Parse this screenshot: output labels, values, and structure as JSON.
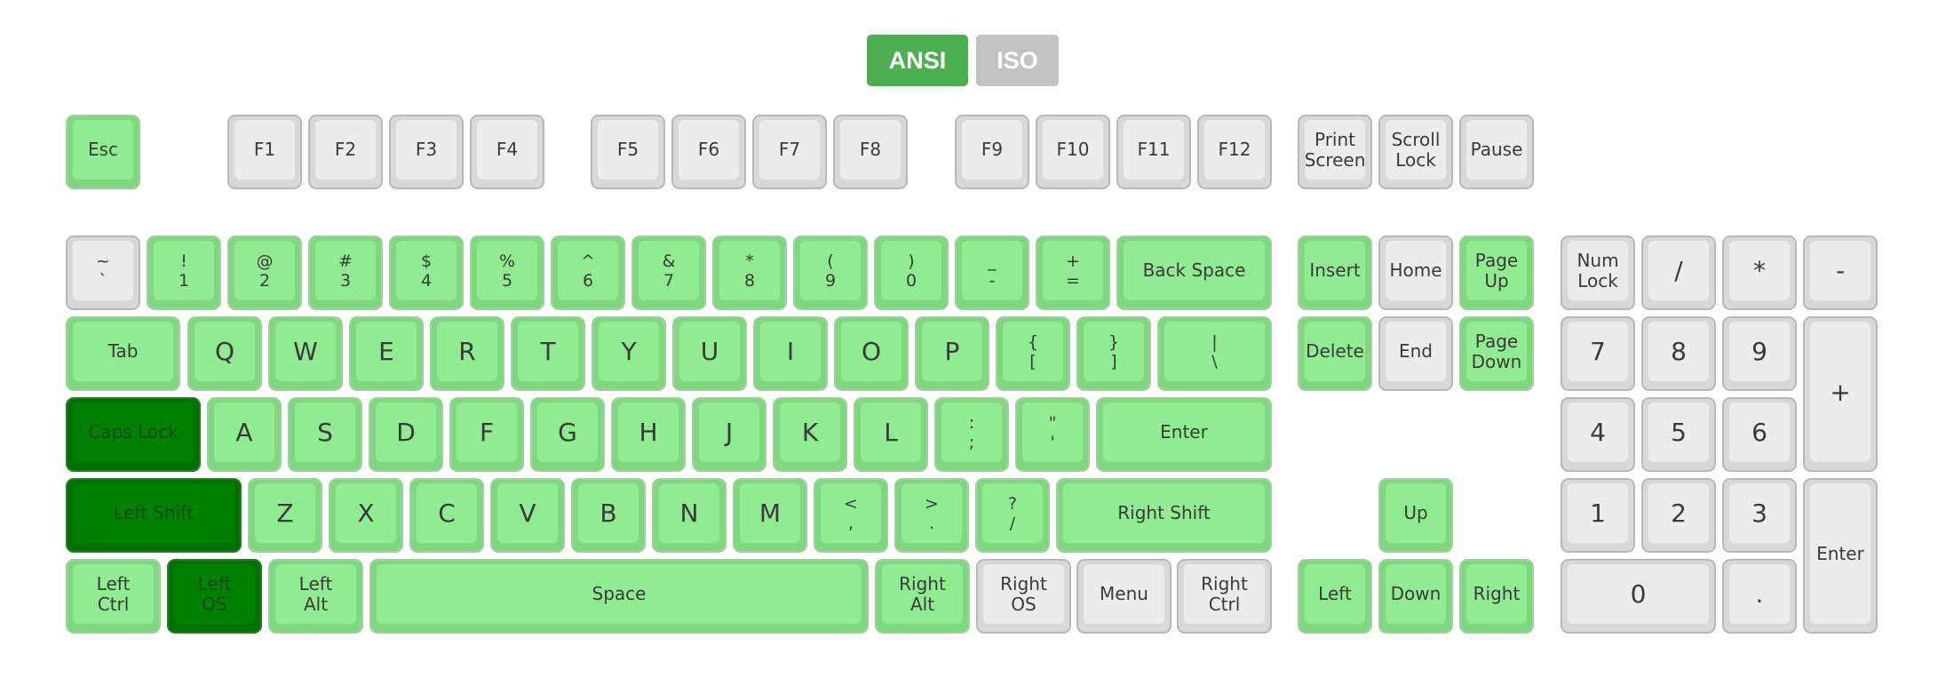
{
  "layout_toggle": {
    "ansi_label": "ANSI",
    "iso_label": "ISO",
    "selected": "ANSI"
  },
  "colors": {
    "pressed": "#90ec90",
    "held": "#008000",
    "idle": "#ececec",
    "toggle_active": "#4caf50",
    "toggle_inactive": "#c2c2c2"
  },
  "keys": [
    {
      "id": "esc",
      "lines": [
        "Esc"
      ],
      "state": "green"
    },
    {
      "id": "f1",
      "lines": [
        "F1"
      ],
      "state": "idle"
    },
    {
      "id": "f2",
      "lines": [
        "F2"
      ],
      "state": "idle"
    },
    {
      "id": "f3",
      "lines": [
        "F3"
      ],
      "state": "idle"
    },
    {
      "id": "f4",
      "lines": [
        "F4"
      ],
      "state": "idle"
    },
    {
      "id": "f5",
      "lines": [
        "F5"
      ],
      "state": "idle"
    },
    {
      "id": "f6",
      "lines": [
        "F6"
      ],
      "state": "idle"
    },
    {
      "id": "f7",
      "lines": [
        "F7"
      ],
      "state": "idle"
    },
    {
      "id": "f8",
      "lines": [
        "F8"
      ],
      "state": "idle"
    },
    {
      "id": "f9",
      "lines": [
        "F9"
      ],
      "state": "idle"
    },
    {
      "id": "f10",
      "lines": [
        "F10"
      ],
      "state": "idle"
    },
    {
      "id": "f11",
      "lines": [
        "F11"
      ],
      "state": "idle"
    },
    {
      "id": "f12",
      "lines": [
        "F12"
      ],
      "state": "idle"
    },
    {
      "id": "print-screen",
      "lines": [
        "Print",
        "Screen"
      ],
      "state": "idle"
    },
    {
      "id": "scroll-lock",
      "lines": [
        "Scroll",
        "Lock"
      ],
      "state": "idle"
    },
    {
      "id": "pause",
      "lines": [
        "Pause"
      ],
      "state": "idle"
    },
    {
      "id": "backtick",
      "lines": [
        "~",
        "`"
      ],
      "state": "idle"
    },
    {
      "id": "digit-1",
      "lines": [
        "!",
        "1"
      ],
      "state": "green"
    },
    {
      "id": "digit-2",
      "lines": [
        "@",
        "2"
      ],
      "state": "green"
    },
    {
      "id": "digit-3",
      "lines": [
        "#",
        "3"
      ],
      "state": "green"
    },
    {
      "id": "digit-4",
      "lines": [
        "$",
        "4"
      ],
      "state": "green"
    },
    {
      "id": "digit-5",
      "lines": [
        "%",
        "5"
      ],
      "state": "green"
    },
    {
      "id": "digit-6",
      "lines": [
        "^",
        "6"
      ],
      "state": "green"
    },
    {
      "id": "digit-7",
      "lines": [
        "&",
        "7"
      ],
      "state": "green"
    },
    {
      "id": "digit-8",
      "lines": [
        "*",
        "8"
      ],
      "state": "green"
    },
    {
      "id": "digit-9",
      "lines": [
        "(",
        "9"
      ],
      "state": "green"
    },
    {
      "id": "digit-0",
      "lines": [
        ")",
        "0"
      ],
      "state": "green"
    },
    {
      "id": "minus",
      "lines": [
        "_",
        "-"
      ],
      "state": "green"
    },
    {
      "id": "equal",
      "lines": [
        "+",
        "="
      ],
      "state": "green"
    },
    {
      "id": "backspace",
      "lines": [
        "Back Space"
      ],
      "state": "green"
    },
    {
      "id": "insert",
      "lines": [
        "Insert"
      ],
      "state": "green"
    },
    {
      "id": "home",
      "lines": [
        "Home"
      ],
      "state": "idle"
    },
    {
      "id": "page-up",
      "lines": [
        "Page",
        "Up"
      ],
      "state": "green"
    },
    {
      "id": "num-lock",
      "lines": [
        "Num",
        "Lock"
      ],
      "state": "idle"
    },
    {
      "id": "numpad-divide",
      "lines": [
        "/"
      ],
      "state": "idle"
    },
    {
      "id": "numpad-multiply",
      "lines": [
        "*"
      ],
      "state": "idle"
    },
    {
      "id": "numpad-minus",
      "lines": [
        "-"
      ],
      "state": "idle"
    },
    {
      "id": "tab",
      "lines": [
        "Tab"
      ],
      "state": "green"
    },
    {
      "id": "q",
      "lines": [
        "Q"
      ],
      "state": "green"
    },
    {
      "id": "w",
      "lines": [
        "W"
      ],
      "state": "green"
    },
    {
      "id": "e",
      "lines": [
        "E"
      ],
      "state": "green"
    },
    {
      "id": "r",
      "lines": [
        "R"
      ],
      "state": "green"
    },
    {
      "id": "t",
      "lines": [
        "T"
      ],
      "state": "green"
    },
    {
      "id": "y",
      "lines": [
        "Y"
      ],
      "state": "green"
    },
    {
      "id": "u",
      "lines": [
        "U"
      ],
      "state": "green"
    },
    {
      "id": "i",
      "lines": [
        "I"
      ],
      "state": "green"
    },
    {
      "id": "o",
      "lines": [
        "O"
      ],
      "state": "green"
    },
    {
      "id": "p",
      "lines": [
        "P"
      ],
      "state": "green"
    },
    {
      "id": "bracket-left",
      "lines": [
        "{",
        "["
      ],
      "state": "green"
    },
    {
      "id": "bracket-right",
      "lines": [
        "}",
        "]"
      ],
      "state": "green"
    },
    {
      "id": "backslash",
      "lines": [
        "|",
        "\\"
      ],
      "state": "green"
    },
    {
      "id": "delete",
      "lines": [
        "Delete"
      ],
      "state": "green"
    },
    {
      "id": "end",
      "lines": [
        "End"
      ],
      "state": "idle"
    },
    {
      "id": "page-down",
      "lines": [
        "Page",
        "Down"
      ],
      "state": "green"
    },
    {
      "id": "numpad-7",
      "lines": [
        "7"
      ],
      "state": "idle"
    },
    {
      "id": "numpad-8",
      "lines": [
        "8"
      ],
      "state": "idle"
    },
    {
      "id": "numpad-9",
      "lines": [
        "9"
      ],
      "state": "idle"
    },
    {
      "id": "numpad-plus",
      "lines": [
        "+"
      ],
      "state": "idle"
    },
    {
      "id": "caps-lock",
      "lines": [
        "Caps Lock"
      ],
      "state": "dark"
    },
    {
      "id": "a",
      "lines": [
        "A"
      ],
      "state": "green"
    },
    {
      "id": "s",
      "lines": [
        "S"
      ],
      "state": "green"
    },
    {
      "id": "d",
      "lines": [
        "D"
      ],
      "state": "green"
    },
    {
      "id": "f",
      "lines": [
        "F"
      ],
      "state": "green"
    },
    {
      "id": "g",
      "lines": [
        "G"
      ],
      "state": "green"
    },
    {
      "id": "h",
      "lines": [
        "H"
      ],
      "state": "green"
    },
    {
      "id": "j",
      "lines": [
        "J"
      ],
      "state": "green"
    },
    {
      "id": "k",
      "lines": [
        "K"
      ],
      "state": "green"
    },
    {
      "id": "l",
      "lines": [
        "L"
      ],
      "state": "green"
    },
    {
      "id": "semicolon",
      "lines": [
        ":",
        ";"
      ],
      "state": "green"
    },
    {
      "id": "quote",
      "lines": [
        "\"",
        "'"
      ],
      "state": "green"
    },
    {
      "id": "enter",
      "lines": [
        "Enter"
      ],
      "state": "green"
    },
    {
      "id": "numpad-4",
      "lines": [
        "4"
      ],
      "state": "idle"
    },
    {
      "id": "numpad-5",
      "lines": [
        "5"
      ],
      "state": "idle"
    },
    {
      "id": "numpad-6",
      "lines": [
        "6"
      ],
      "state": "idle"
    },
    {
      "id": "left-shift",
      "lines": [
        "Left Shift"
      ],
      "state": "dark"
    },
    {
      "id": "z",
      "lines": [
        "Z"
      ],
      "state": "green"
    },
    {
      "id": "x",
      "lines": [
        "X"
      ],
      "state": "green"
    },
    {
      "id": "c",
      "lines": [
        "C"
      ],
      "state": "green"
    },
    {
      "id": "v",
      "lines": [
        "V"
      ],
      "state": "green"
    },
    {
      "id": "b",
      "lines": [
        "B"
      ],
      "state": "green"
    },
    {
      "id": "n",
      "lines": [
        "N"
      ],
      "state": "green"
    },
    {
      "id": "m",
      "lines": [
        "M"
      ],
      "state": "green"
    },
    {
      "id": "comma",
      "lines": [
        "<",
        ","
      ],
      "state": "green"
    },
    {
      "id": "period",
      "lines": [
        ">",
        "."
      ],
      "state": "green"
    },
    {
      "id": "slash",
      "lines": [
        "?",
        "/"
      ],
      "state": "green"
    },
    {
      "id": "right-shift",
      "lines": [
        "Right Shift"
      ],
      "state": "green"
    },
    {
      "id": "arrow-up",
      "lines": [
        "Up"
      ],
      "state": "green"
    },
    {
      "id": "numpad-1",
      "lines": [
        "1"
      ],
      "state": "idle"
    },
    {
      "id": "numpad-2",
      "lines": [
        "2"
      ],
      "state": "idle"
    },
    {
      "id": "numpad-3",
      "lines": [
        "3"
      ],
      "state": "idle"
    },
    {
      "id": "numpad-enter",
      "lines": [
        "Enter"
      ],
      "state": "idle"
    },
    {
      "id": "left-ctrl",
      "lines": [
        "Left",
        "Ctrl"
      ],
      "state": "green"
    },
    {
      "id": "left-os",
      "lines": [
        "Left",
        "OS"
      ],
      "state": "dark"
    },
    {
      "id": "left-alt",
      "lines": [
        "Left",
        "Alt"
      ],
      "state": "green"
    },
    {
      "id": "space",
      "lines": [
        "Space"
      ],
      "state": "green"
    },
    {
      "id": "right-alt",
      "lines": [
        "Right",
        "Alt"
      ],
      "state": "green"
    },
    {
      "id": "right-os",
      "lines": [
        "Right",
        "OS"
      ],
      "state": "idle"
    },
    {
      "id": "menu",
      "lines": [
        "Menu"
      ],
      "state": "idle"
    },
    {
      "id": "right-ctrl",
      "lines": [
        "Right",
        "Ctrl"
      ],
      "state": "idle"
    },
    {
      "id": "arrow-left",
      "lines": [
        "Left"
      ],
      "state": "green"
    },
    {
      "id": "arrow-down",
      "lines": [
        "Down"
      ],
      "state": "green"
    },
    {
      "id": "arrow-right",
      "lines": [
        "Right"
      ],
      "state": "green"
    },
    {
      "id": "numpad-0",
      "lines": [
        "0"
      ],
      "state": "idle"
    },
    {
      "id": "numpad-decimal",
      "lines": [
        "."
      ],
      "state": "idle"
    }
  ]
}
